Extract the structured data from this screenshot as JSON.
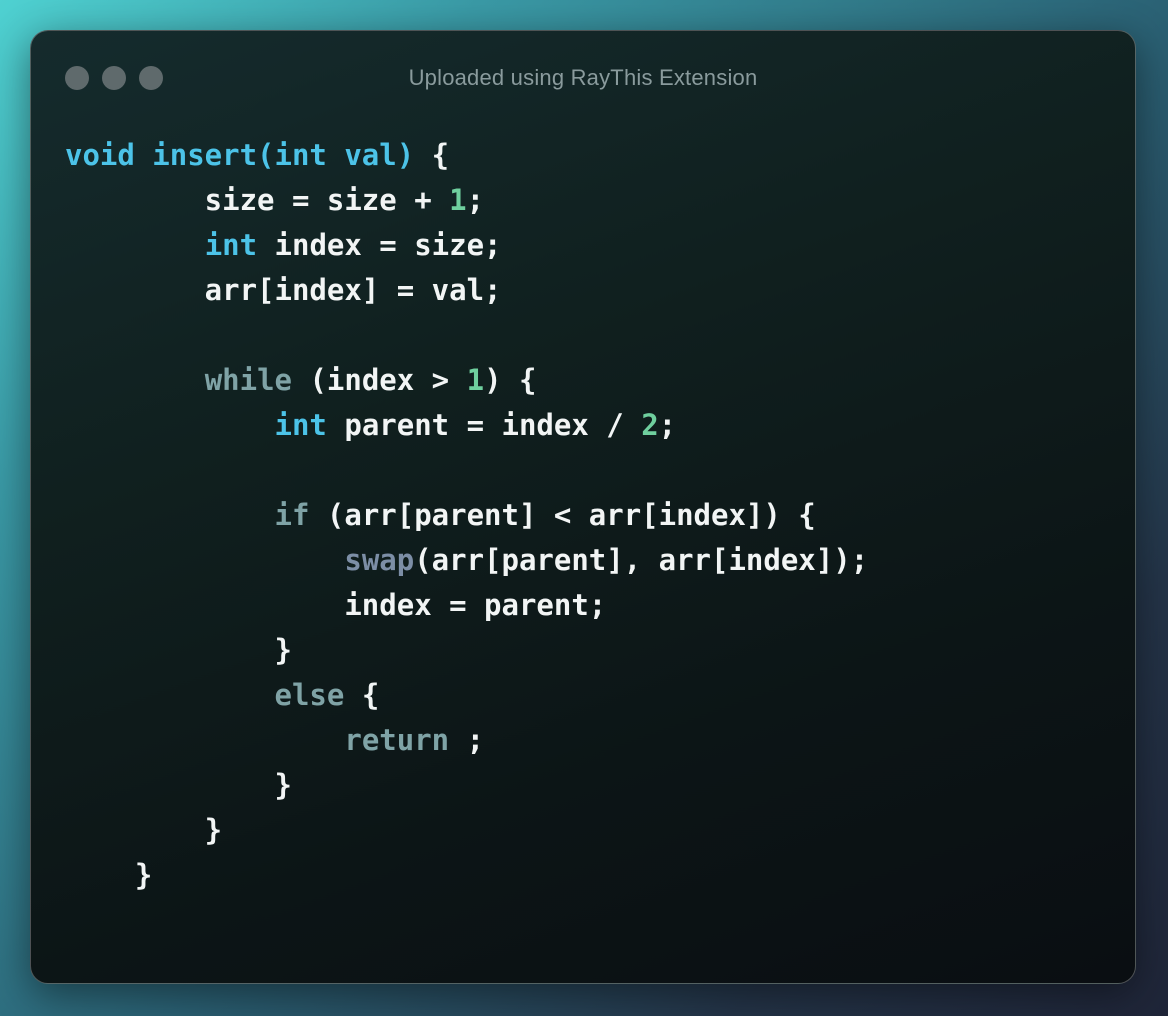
{
  "window": {
    "title": "Uploaded using RayThis Extension"
  },
  "code": {
    "language": "cpp",
    "lines": [
      {
        "tokens": [
          {
            "text": "void insert(int val) ",
            "type": "kw-blue"
          },
          {
            "text": "{",
            "type": "plain"
          }
        ]
      },
      {
        "tokens": [
          {
            "text": "        size = size + ",
            "type": "plain"
          },
          {
            "text": "1",
            "type": "num"
          },
          {
            "text": ";",
            "type": "plain"
          }
        ]
      },
      {
        "tokens": [
          {
            "text": "        ",
            "type": "plain"
          },
          {
            "text": "int",
            "type": "kw-blue"
          },
          {
            "text": " index = size;",
            "type": "plain"
          }
        ]
      },
      {
        "tokens": [
          {
            "text": "        arr[index] = val;",
            "type": "plain"
          }
        ]
      },
      {
        "tokens": []
      },
      {
        "tokens": [
          {
            "text": "        ",
            "type": "plain"
          },
          {
            "text": "while",
            "type": "kw-muted"
          },
          {
            "text": " (index > ",
            "type": "plain"
          },
          {
            "text": "1",
            "type": "num"
          },
          {
            "text": ") {",
            "type": "plain"
          }
        ]
      },
      {
        "tokens": [
          {
            "text": "            ",
            "type": "plain"
          },
          {
            "text": "int",
            "type": "kw-blue"
          },
          {
            "text": " parent = index / ",
            "type": "plain"
          },
          {
            "text": "2",
            "type": "num"
          },
          {
            "text": ";",
            "type": "plain"
          }
        ]
      },
      {
        "tokens": []
      },
      {
        "tokens": [
          {
            "text": "            ",
            "type": "plain"
          },
          {
            "text": "if",
            "type": "kw-muted"
          },
          {
            "text": " (arr[parent] < arr[index]) {",
            "type": "plain"
          }
        ]
      },
      {
        "tokens": [
          {
            "text": "                ",
            "type": "plain"
          },
          {
            "text": "swap",
            "type": "fn-muted"
          },
          {
            "text": "(arr[parent], arr[index]);",
            "type": "plain"
          }
        ]
      },
      {
        "tokens": [
          {
            "text": "                index = parent;",
            "type": "plain"
          }
        ]
      },
      {
        "tokens": [
          {
            "text": "            }",
            "type": "plain"
          }
        ]
      },
      {
        "tokens": [
          {
            "text": "            ",
            "type": "plain"
          },
          {
            "text": "else",
            "type": "kw-muted"
          },
          {
            "text": " {",
            "type": "plain"
          }
        ]
      },
      {
        "tokens": [
          {
            "text": "                ",
            "type": "plain"
          },
          {
            "text": "return",
            "type": "kw-muted"
          },
          {
            "text": " ;",
            "type": "plain"
          }
        ]
      },
      {
        "tokens": [
          {
            "text": "            }",
            "type": "plain"
          }
        ]
      },
      {
        "tokens": [
          {
            "text": "        }",
            "type": "plain"
          }
        ]
      },
      {
        "tokens": [
          {
            "text": "    }",
            "type": "plain"
          }
        ]
      }
    ]
  },
  "colors": {
    "window_dots": "#5f6a6c",
    "keyword_blue": "#4cc3e8",
    "keyword_muted": "#7fa3a6",
    "number": "#6fcf9e",
    "function_muted": "#7c8ea6",
    "text": "#f2f5f5",
    "title_text": "#8a9b9d"
  }
}
